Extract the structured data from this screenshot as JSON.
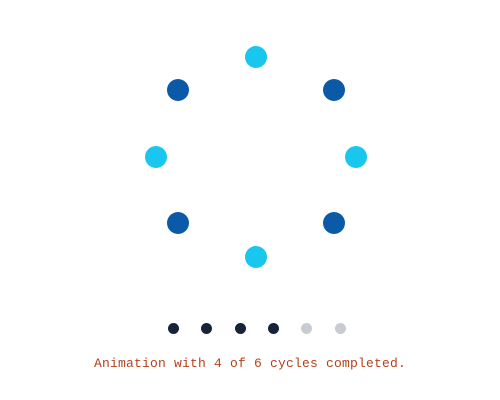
{
  "spinner": {
    "label": "loading-spinner",
    "dots": [
      {
        "name": "spinner-dot-top",
        "color": "#19c6ee"
      },
      {
        "name": "spinner-dot-top-right",
        "color": "#0a5aa8"
      },
      {
        "name": "spinner-dot-right",
        "color": "#19c6ee"
      },
      {
        "name": "spinner-dot-bottom-right",
        "color": "#0a5aa8"
      },
      {
        "name": "spinner-dot-bottom",
        "color": "#19c6ee"
      },
      {
        "name": "spinner-dot-bottom-left",
        "color": "#0a5aa8"
      },
      {
        "name": "spinner-dot-left",
        "color": "#19c6ee"
      },
      {
        "name": "spinner-dot-top-left",
        "color": "#0a5aa8"
      }
    ]
  },
  "progress": {
    "completed": 4,
    "total": 6,
    "completed_color": "#16243a",
    "pending_color": "#c8ccd2"
  },
  "caption": {
    "text": "Animation with 4 of 6 cycles completed.",
    "color": "#b5411c"
  }
}
